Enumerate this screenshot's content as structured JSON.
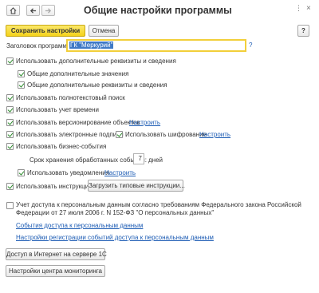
{
  "window": {
    "title": "Общие настройки программы",
    "icons": {
      "home": "home-icon",
      "back": "arrow-left-icon",
      "forward": "arrow-right-icon",
      "menu": "more-vertical-icon",
      "close": "close-icon"
    }
  },
  "toolbar": {
    "save_close": "Сохранить настройки",
    "cancel": "Отмена",
    "help": "?"
  },
  "header_field": {
    "label": "Заголовок программы:",
    "value": "ГК \"Меркурий\"",
    "hint": "?"
  },
  "options": {
    "extra_details": "Использовать дополнительные реквизиты и сведения",
    "extra_values": "Общие дополнительные значения",
    "extra_details_info": "Общие дополнительные реквизиты и сведения",
    "fulltext_search": "Использовать полнотекстовый поиск",
    "time_tracking": "Использовать учет времени",
    "versioning": "Использовать версионирование объектов",
    "versioning_link": "Настроить",
    "e_signature": "Использовать электронные подписи",
    "encryption": "Использовать шифрование",
    "encryption_link": "Настроить",
    "business_events": "Использовать бизнес-события",
    "retention_label": "Срок хранения обработанных событий:",
    "retention_value": "7",
    "retention_unit": "дней",
    "notifications": "Использовать уведомления",
    "notifications_link": "Настроить",
    "instructions": "Использовать инструкции",
    "load_instructions": "Загрузить типовые инструкции...",
    "personal_data": "Учет доступа к персональным данным согласно требованиям  Федерального закона Российской Федерации от 27 июля 2006 г. N 152-ФЗ \"О персональных данных\"",
    "pd_events_link": "События доступа к персональным данным",
    "pd_settings_link": "Настройки регистрации событий доступа к персональным данным"
  },
  "buttons": {
    "internet_access": "Доступ в Интернет на сервере 1С",
    "monitoring": "Настройки центра мониторинга"
  },
  "colors": {
    "primary_button": "#f4d21b",
    "link": "#1a5ab3",
    "checkmark": "#2a8a2a"
  }
}
